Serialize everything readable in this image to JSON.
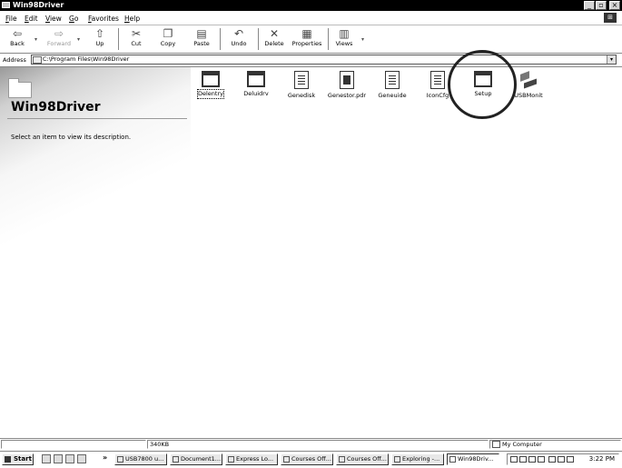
{
  "window": {
    "title": "Win98Driver",
    "min_label": "_",
    "max_label": "▫",
    "close_label": "×"
  },
  "menu": {
    "items": [
      "File",
      "Edit",
      "View",
      "Go",
      "Favorites",
      "Help"
    ]
  },
  "toolbar": {
    "buttons": [
      {
        "label": "Back",
        "icon": "back-arrow-icon",
        "glyph": "⇦",
        "enabled": true
      },
      {
        "label": "Forward",
        "icon": "forward-arrow-icon",
        "glyph": "⇨",
        "enabled": false
      },
      {
        "label": "Up",
        "icon": "up-folder-icon",
        "glyph": "⇧",
        "enabled": true
      },
      {
        "label": "Cut",
        "icon": "scissors-icon",
        "glyph": "✂",
        "enabled": true
      },
      {
        "label": "Copy",
        "icon": "copy-icon",
        "glyph": "❐",
        "enabled": true
      },
      {
        "label": "Paste",
        "icon": "paste-icon",
        "glyph": "▤",
        "enabled": true
      },
      {
        "label": "Undo",
        "icon": "undo-icon",
        "glyph": "↶",
        "enabled": true
      },
      {
        "label": "Delete",
        "icon": "delete-x-icon",
        "glyph": "✕",
        "enabled": true
      },
      {
        "label": "Properties",
        "icon": "properties-icon",
        "glyph": "▦",
        "enabled": true
      },
      {
        "label": "Views",
        "icon": "views-icon",
        "glyph": "▥",
        "enabled": true
      }
    ]
  },
  "address": {
    "label": "Address",
    "value": "C:\\Program Files\\Win98Driver"
  },
  "left_pane": {
    "folder_name": "Win98Driver",
    "description": "Select an item to view its description."
  },
  "files": [
    {
      "name": "Delentry",
      "icon": "application-icon",
      "selected": true
    },
    {
      "name": "Deluidrv",
      "icon": "application-icon",
      "selected": false
    },
    {
      "name": "Genedisk",
      "icon": "document-icon",
      "selected": false
    },
    {
      "name": "Genestor.pdr",
      "icon": "pdr-file-icon",
      "selected": false
    },
    {
      "name": "Geneuide",
      "icon": "document-icon",
      "selected": false
    },
    {
      "name": "IconCfg",
      "icon": "document-icon",
      "selected": false
    },
    {
      "name": "Setup",
      "icon": "application-icon",
      "selected": false,
      "highlighted": true
    },
    {
      "name": "USBMonit",
      "icon": "usb-monitor-icon",
      "selected": false
    }
  ],
  "status": {
    "size": "340KB",
    "location": "My Computer"
  },
  "taskbar": {
    "start_label": "Start",
    "more_label": "»",
    "tasks": [
      {
        "label": "USB7800 u...",
        "active": false
      },
      {
        "label": "Document1...",
        "active": false
      },
      {
        "label": "Express Lo...",
        "active": false
      },
      {
        "label": "Courses Off...",
        "active": false
      },
      {
        "label": "Courses Off...",
        "active": false
      },
      {
        "label": "Exploring -...",
        "active": false
      },
      {
        "label": "Win98Driv...",
        "active": true
      }
    ],
    "clock": "3:22 PM"
  }
}
